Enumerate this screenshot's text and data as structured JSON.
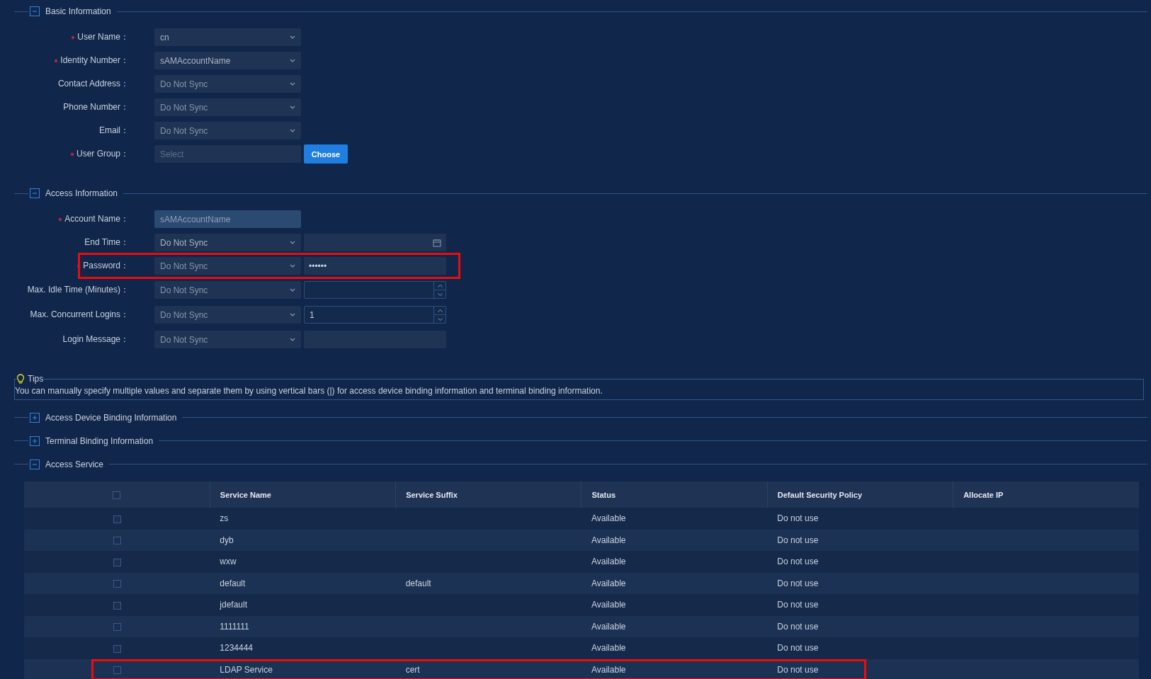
{
  "sections": [
    {
      "title": "Basic Information",
      "expanded": true,
      "fields": [
        {
          "label": "User Name：",
          "required": true,
          "highlighted": false,
          "control": {
            "kind": "select",
            "value": "cn"
          }
        },
        {
          "label": "Identity Number：",
          "required": true,
          "highlighted": false,
          "control": {
            "kind": "select",
            "value": "sAMAccountName"
          }
        },
        {
          "label": "Contact Address：",
          "required": false,
          "highlighted": false,
          "control": {
            "kind": "select",
            "value": "Do Not Sync"
          }
        },
        {
          "label": "Phone Number：",
          "required": false,
          "highlighted": false,
          "control": {
            "kind": "select",
            "value": "Do Not Sync"
          }
        },
        {
          "label": "Email：",
          "required": false,
          "highlighted": false,
          "control": {
            "kind": "select",
            "value": "Do Not Sync"
          }
        },
        {
          "label": "User Group：",
          "required": true,
          "highlighted": false,
          "control": {
            "kind": "picker",
            "placeholder": "Select"
          },
          "extra": {
            "kind": "button",
            "label": "Choose"
          }
        }
      ]
    },
    {
      "title": "Access Information",
      "expanded": true,
      "fields": [
        {
          "label": "Account Name：",
          "required": true,
          "highlighted": false,
          "control": {
            "kind": "text",
            "value": "sAMAccountName"
          }
        },
        {
          "label": "End Time：",
          "required": false,
          "highlighted": false,
          "control": {
            "kind": "select",
            "value": "Do Not Sync"
          },
          "extra": {
            "kind": "date"
          }
        },
        {
          "label": "Password：",
          "required": true,
          "highlighted": true,
          "control": {
            "kind": "select",
            "value": "Do Not Sync"
          },
          "extra": {
            "kind": "password",
            "value": "••••••"
          }
        },
        {
          "label": "Max. Idle Time (Minutes)：",
          "required": false,
          "highlighted": false,
          "control": {
            "kind": "select",
            "value": "Do Not Sync"
          },
          "extra": {
            "kind": "number"
          }
        },
        {
          "label": "Max. Concurrent Logins：",
          "required": false,
          "highlighted": false,
          "control": {
            "kind": "select",
            "value": "Do Not Sync"
          },
          "extra": {
            "kind": "number",
            "value": "1"
          }
        },
        {
          "label": "Login Message：",
          "required": false,
          "highlighted": false,
          "control": {
            "kind": "select",
            "value": "Do Not Sync"
          },
          "extra": {
            "kind": "text"
          }
        }
      ]
    }
  ],
  "tips": {
    "title": "Tips",
    "text": "You can manually specify multiple values and separate them by using vertical bars (|) for access device binding information and terminal binding information."
  },
  "collapsibles": [
    {
      "title": "Access Device Binding Information",
      "expanded": false
    },
    {
      "title": "Terminal Binding Information",
      "expanded": false
    },
    {
      "title": "Access Service",
      "expanded": true
    }
  ],
  "table": {
    "header_checked": false,
    "columns": [
      "Service Name",
      "Service Suffix",
      "Status",
      "Default Security Policy",
      "Allocate IP"
    ],
    "rows": [
      {
        "checked": false,
        "highlighted": false,
        "cells": [
          "zs",
          "",
          "Available",
          "Do not use",
          ""
        ]
      },
      {
        "checked": false,
        "highlighted": false,
        "cells": [
          "dyb",
          "",
          "Available",
          "Do not use",
          ""
        ]
      },
      {
        "checked": false,
        "highlighted": false,
        "cells": [
          "wxw",
          "",
          "Available",
          "Do not use",
          ""
        ]
      },
      {
        "checked": false,
        "highlighted": false,
        "cells": [
          "default",
          "default",
          "Available",
          "Do not use",
          ""
        ]
      },
      {
        "checked": false,
        "highlighted": false,
        "cells": [
          "jdefault",
          "",
          "Available",
          "Do not use",
          ""
        ]
      },
      {
        "checked": false,
        "highlighted": false,
        "cells": [
          "1111111",
          "",
          "Available",
          "Do not use",
          ""
        ]
      },
      {
        "checked": false,
        "highlighted": false,
        "cells": [
          "1234444",
          "",
          "Available",
          "Do not use",
          ""
        ]
      },
      {
        "checked": false,
        "highlighted": true,
        "cells": [
          "LDAP Service",
          "cert",
          "Available",
          "Do not use",
          ""
        ]
      }
    ]
  }
}
